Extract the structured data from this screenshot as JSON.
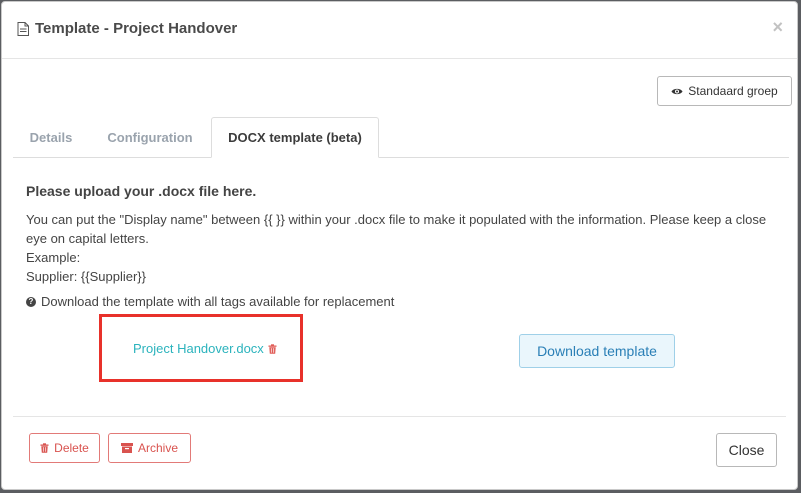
{
  "modal": {
    "title": "Template - Project Handover",
    "close_glyph": "×",
    "title_icon": "document-icon"
  },
  "toolbar": {
    "standaard_label": "Standaard groep",
    "standaard_icon": "eye-icon"
  },
  "tabs": [
    {
      "label": "Details",
      "active": false
    },
    {
      "label": "Configuration",
      "active": false
    },
    {
      "label": "DOCX template (beta)",
      "active": true
    }
  ],
  "content": {
    "title": "Please upload your .docx file here.",
    "description_line1": "You can put the \"Display name\" between {{ }} within your .docx file to make it populated with the information. Please keep a close eye on capital letters.",
    "example_label": "Example:",
    "example_value": "Supplier: {{Supplier}}",
    "download_note": "Download the template with all tags available for replacement",
    "file_name": "Project Handover.docx",
    "download_button": "Download template"
  },
  "footer": {
    "delete_label": "Delete",
    "archive_label": "Archive",
    "close_label": "Close"
  },
  "colors": {
    "accent_link": "#2bb3bd",
    "danger": "#d9534f",
    "highlight": "#e8312a",
    "info_button_text": "#2a7fb6"
  }
}
